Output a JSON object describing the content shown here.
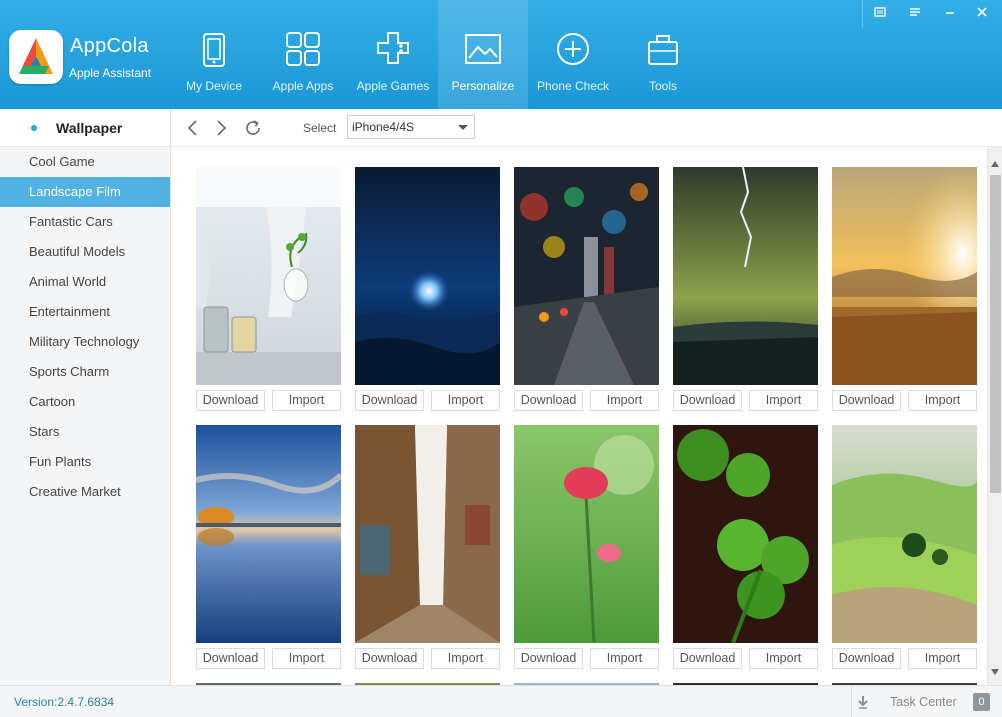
{
  "app": {
    "name": "AppCola",
    "subtitle": "Apple Assistant"
  },
  "nav": {
    "items": [
      {
        "label": "My Device",
        "icon": "tablet-icon"
      },
      {
        "label": "Apple Apps",
        "icon": "apps-grid-icon"
      },
      {
        "label": "Apple Games",
        "icon": "gamepad-icon"
      },
      {
        "label": "Personalize",
        "icon": "picture-icon",
        "active": true
      },
      {
        "label": "Phone Check",
        "icon": "plus-circle-icon"
      },
      {
        "label": "Tools",
        "icon": "toolbox-icon"
      }
    ]
  },
  "window_controls": {
    "menu": "menu-icon",
    "settings": "settings-icon",
    "minimize": "minimize-icon",
    "close": "close-icon"
  },
  "sidebar": {
    "title": "Wallpaper",
    "items": [
      "Cool Game",
      "Landscape Film",
      "Fantastic Cars",
      "Beautiful Models",
      "Animal World",
      "Entertainment",
      "Military Technology",
      "Sports Charm",
      "Cartoon",
      "Stars",
      "Fun Plants",
      "Creative Market"
    ],
    "selected": "Landscape Film"
  },
  "toolbar": {
    "select_label": "Select",
    "device_value": "iPhone4/4S"
  },
  "wallpapers": {
    "download_label": "Download",
    "import_label": "Import",
    "items": [
      "white-window-plant",
      "blue-ocean-moon",
      "blurred-city-street",
      "lightning-storm-sea",
      "golden-sunset-field",
      "autumn-lake-reflection",
      "graffiti-alley",
      "pink-poppy",
      "green-clover",
      "rolling-green-hills"
    ]
  },
  "status": {
    "version": "Version:2.4.7.6834",
    "task_center": "Task Center",
    "task_count": "0"
  },
  "colors": {
    "header": "#1b97d6",
    "accent": "#52b2e2",
    "sidebar_bg": "#f3f5f7"
  }
}
